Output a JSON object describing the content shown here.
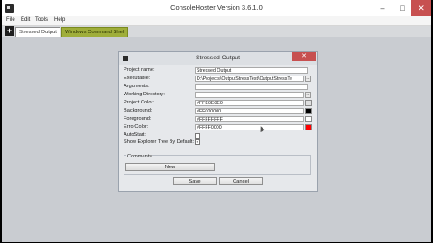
{
  "window": {
    "title": "ConsoleHoster Version 3.6.1.0",
    "minimize_glyph": "–",
    "maximize_glyph": "□",
    "close_glyph": "✕"
  },
  "menu": [
    "File",
    "Edit",
    "Tools",
    "Help"
  ],
  "tabs": {
    "add_glyph": "+",
    "items": [
      {
        "label": "Stressed Output"
      },
      {
        "label": "Windows Command Shell"
      }
    ]
  },
  "dialog": {
    "title": "Stressed Output",
    "close_glyph": "✕",
    "fields": {
      "project_name": {
        "label": "Project name:",
        "value": "Stressed Output"
      },
      "executable": {
        "label": "Executable:",
        "value": "D:\\Projects\\OutputStressTest\\OutputStressTe"
      },
      "arguments": {
        "label": "Arguments:",
        "value": ""
      },
      "working_directory": {
        "label": "Working Directory:",
        "value": ""
      },
      "project_color": {
        "label": "Project Color:",
        "value": "#FFE0E0E0"
      },
      "background": {
        "label": "Background:",
        "value": "#FF000000"
      },
      "foreground": {
        "label": "Foreground:",
        "value": "#FFFFFFFF"
      },
      "error_color": {
        "label": "ErrorColor:",
        "value": "#FFFF0000"
      },
      "autostart": {
        "label": "AutoStart:",
        "checked": false
      },
      "show_explorer_tree": {
        "label": "Show Explorer Tree By Default:",
        "checked": true
      }
    },
    "browse_glyph": "...",
    "swatch_colors": {
      "project_color": "#E0E0E0",
      "background": "#000000",
      "foreground": "#FFFFFF",
      "error_color": "#FF0000"
    },
    "comments": {
      "label": "Comments",
      "new_button": "New"
    },
    "save_button": "Save",
    "cancel_button": "Cancel"
  }
}
